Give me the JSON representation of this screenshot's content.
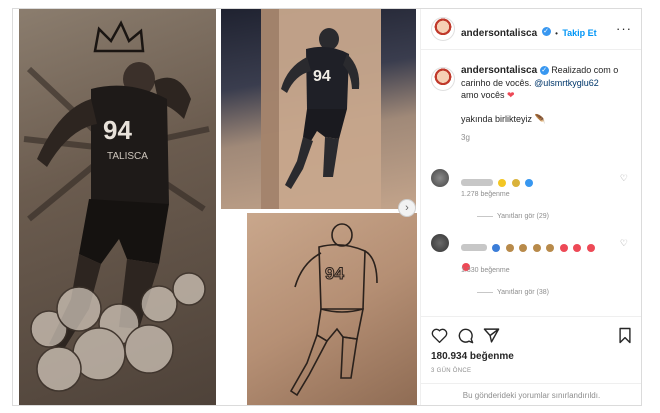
{
  "post": {
    "username": "andersontalisca",
    "follow_label": "Takip Et",
    "caption_line1": "Realizado com o",
    "caption_line2": "carinho de vocês.",
    "caption_mention": "@ulsmrtkyglu62",
    "caption_line3": "amo vocês",
    "caption_heart": "❤",
    "second_line": "yakında birlikteyiz",
    "second_emoji": "🪶",
    "caption_age": "3g"
  },
  "comments": [
    {
      "likes": "1.278 beğenme",
      "replies": "Yanıtları gör (29)"
    },
    {
      "likes": "1.330 beğenme",
      "replies": "Yanıtları gör (38)"
    }
  ],
  "footer": {
    "likes": "180.934 beğenme",
    "time_ago": "3 GÜN ÖNCE",
    "limited_text": "Bu gönderideki yorumlar sınırlandırıldı."
  },
  "photos": {
    "jersey_number": "94",
    "jersey_name": "TALISCA"
  },
  "colors": {
    "accent": "#0095f6",
    "verified": "#3897f0",
    "heart": "#ed4956",
    "text": "#262626",
    "muted": "#8e8e8e"
  },
  "icons": [
    "verified-icon",
    "more-options-icon",
    "heart-icon",
    "comment-icon",
    "share-icon",
    "bookmark-icon",
    "next-arrow-icon",
    "crown-icon"
  ]
}
